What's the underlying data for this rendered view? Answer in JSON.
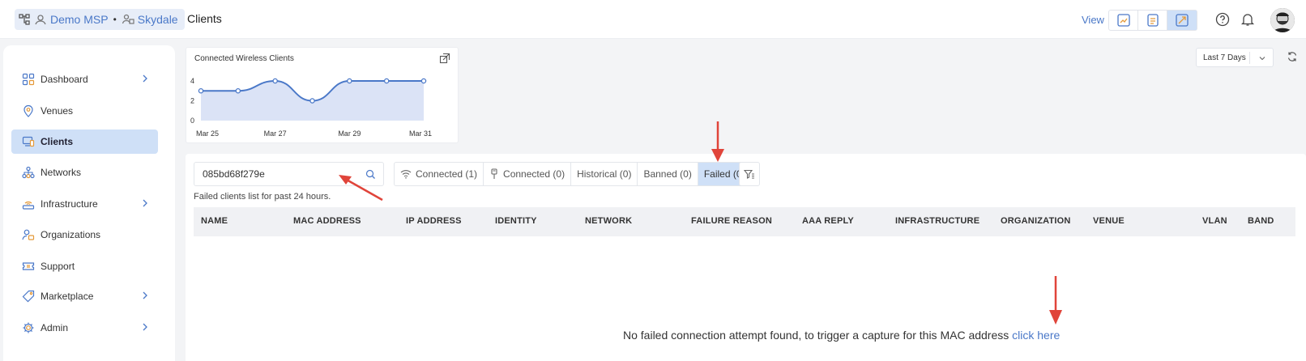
{
  "header": {
    "org": "Demo MSP",
    "separator": "•",
    "tenant": "Skydale",
    "page_title": "Clients",
    "view_label": "View"
  },
  "sidebar": {
    "items": [
      {
        "label": "Dashboard",
        "icon": "dashboard-icon",
        "has_children": true
      },
      {
        "label": "Venues",
        "icon": "location-pin-icon",
        "has_children": false
      },
      {
        "label": "Clients",
        "icon": "clients-icon",
        "has_children": false,
        "active": true
      },
      {
        "label": "Networks",
        "icon": "networks-icon",
        "has_children": false
      },
      {
        "label": "Infrastructure",
        "icon": "wifi-router-icon",
        "has_children": true
      },
      {
        "label": "Organizations",
        "icon": "organizations-icon",
        "has_children": false
      },
      {
        "label": "Support",
        "icon": "ticket-icon",
        "has_children": false
      },
      {
        "label": "Marketplace",
        "icon": "tag-icon",
        "has_children": true
      },
      {
        "label": "Admin",
        "icon": "gear-icon",
        "has_children": true
      }
    ]
  },
  "chart": {
    "title": "Connected Wireless Clients"
  },
  "chart_data": {
    "type": "area",
    "title": "Connected Wireless Clients",
    "x": [
      "Mar 25",
      "Mar 26",
      "Mar 27",
      "Mar 28",
      "Mar 29",
      "Mar 30",
      "Mar 31"
    ],
    "x_tick_labels": [
      "Mar 25",
      "Mar 27",
      "Mar 29",
      "Mar 31"
    ],
    "values": [
      3,
      3,
      4,
      2,
      4,
      4,
      4
    ],
    "y_ticks": [
      "0",
      "2",
      "4"
    ],
    "ylim": [
      0,
      4
    ],
    "color": "#4a78c8",
    "fill": "#dbe3f6"
  },
  "range_select": {
    "value": "Last 7 Days"
  },
  "search": {
    "value": "085bd68f279e",
    "placeholder": "Search"
  },
  "hint": "Failed clients list for past 24 hours.",
  "tabs": [
    {
      "label": "Connected (1)",
      "icon": "wifi-icon"
    },
    {
      "label": "Connected (0)",
      "icon": "ethernet-plug-icon"
    },
    {
      "label": "Historical (0)"
    },
    {
      "label": "Banned (0)"
    },
    {
      "label": "Failed (0)",
      "active": true
    }
  ],
  "table": {
    "columns": [
      "NAME",
      "MAC ADDRESS",
      "IP ADDRESS",
      "IDENTITY",
      "NETWORK",
      "FAILURE REASON",
      "AAA REPLY",
      "INFRASTRUCTURE",
      "ORGANIZATION",
      "VENUE",
      "VLAN",
      "BAND"
    ]
  },
  "empty_state": {
    "message": "No failed connection attempt found, to trigger a capture for this MAC address",
    "link": "click here"
  },
  "colors": {
    "accent": "#4a78c8",
    "active_bg": "#cfe0f7",
    "annotation_arrow": "#e0443a"
  }
}
